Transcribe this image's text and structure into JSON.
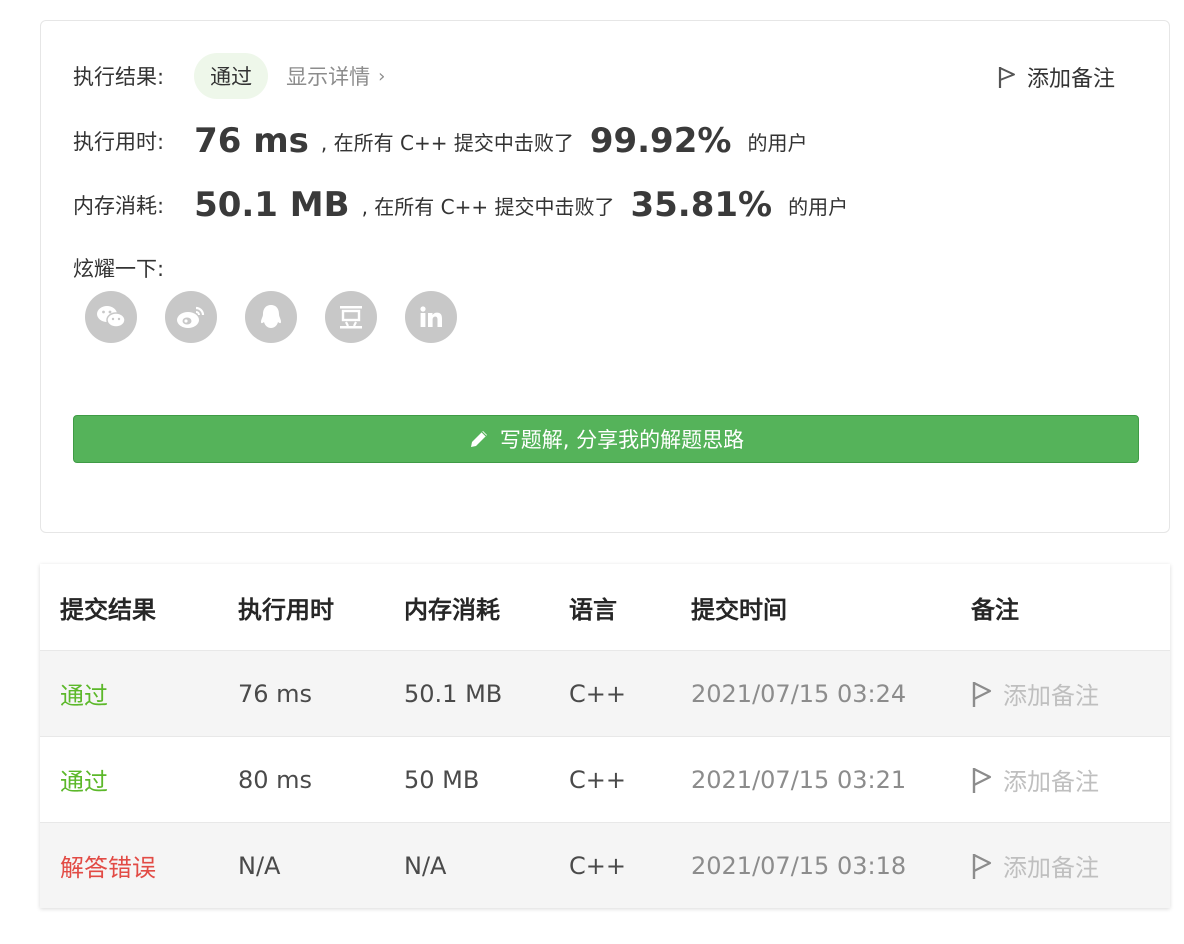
{
  "result": {
    "status_label": "执行结果:",
    "status_value": "通过",
    "details_link": "显示详情",
    "details_chevron": "›",
    "add_note": "添加备注",
    "runtime_label": "执行用时:",
    "runtime_value": "76 ms",
    "runtime_mid": ", 在所有 C++ 提交中击败了",
    "runtime_pct": "99.92%",
    "runtime_suffix": "的用户",
    "memory_label": "内存消耗:",
    "memory_value": "50.1 MB",
    "memory_mid": ", 在所有 C++ 提交中击败了",
    "memory_pct": "35.81%",
    "memory_suffix": "的用户",
    "share_label": "炫耀一下:",
    "share_icons": [
      "wechat-icon",
      "weibo-icon",
      "qq-icon",
      "douban-icon",
      "linkedin-icon"
    ],
    "write_solution": "写题解, 分享我的解题思路"
  },
  "table": {
    "headers": [
      "提交结果",
      "执行用时",
      "内存消耗",
      "语言",
      "提交时间",
      "备注"
    ],
    "rows": [
      {
        "status": "通过",
        "runtime": "76 ms",
        "memory": "50.1 MB",
        "lang": "C++",
        "time": "2021/07/15 03:24",
        "note": "添加备注"
      },
      {
        "status": "通过",
        "runtime": "80 ms",
        "memory": "50 MB",
        "lang": "C++",
        "time": "2021/07/15 03:21",
        "note": "添加备注"
      },
      {
        "status": "解答错误",
        "runtime": "N/A",
        "memory": "N/A",
        "lang": "C++",
        "time": "2021/07/15 03:18",
        "note": "添加备注"
      }
    ]
  },
  "colors": {
    "pass": "#5cb82a",
    "fail": "#e24b45",
    "button": "#55b35a",
    "share_icon_bg": "#c8c8c8"
  }
}
